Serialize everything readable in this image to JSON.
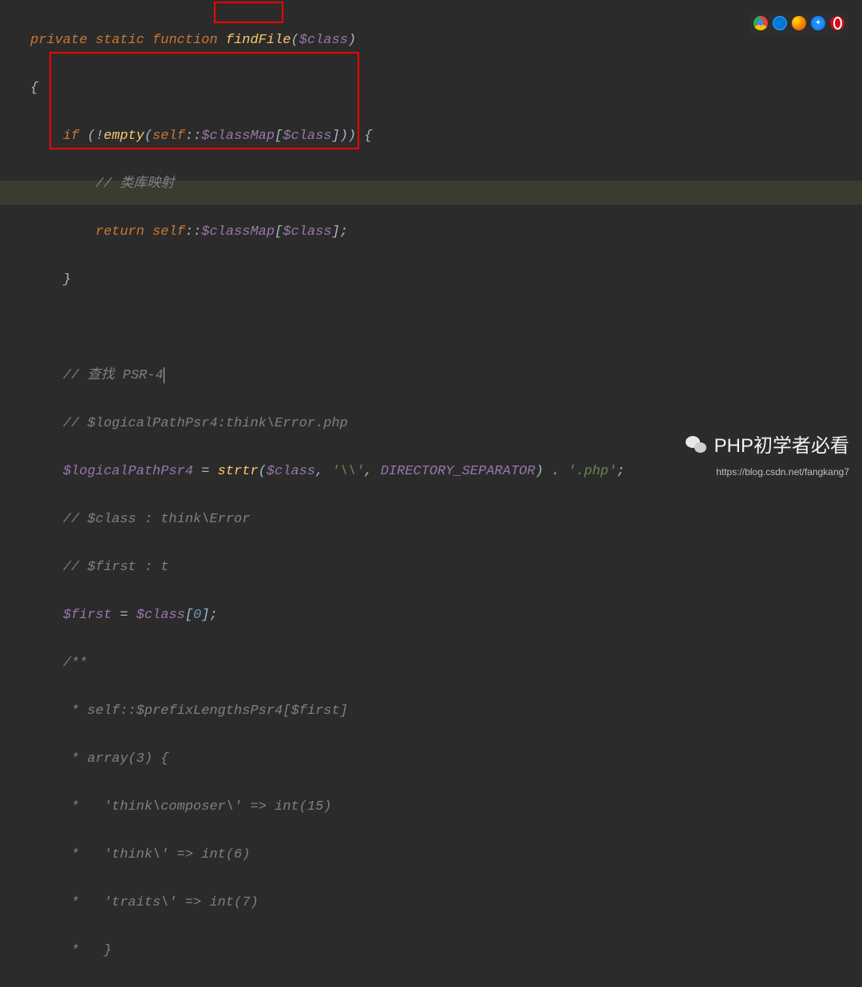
{
  "code": {
    "l1": {
      "private": "private",
      "static": "static",
      "function": "function",
      "name": "findFile",
      "open": "(",
      "var": "$class",
      "close": ")"
    },
    "l2": "{",
    "l3": {
      "if": "if",
      "open": " (!",
      "empty": "empty",
      "p1": "(",
      "self": "self",
      "scope": "::",
      "var": "$classMap",
      "b1": "[",
      "cls": "$class",
      "b2": "])) {"
    },
    "l4": {
      "txt": "// 类库映射"
    },
    "l5": {
      "ret": "return",
      "sp": " ",
      "self": "self",
      "scope": "::",
      "var": "$classMap",
      "b1": "[",
      "cls": "$class",
      "b2": "];"
    },
    "l6": "}",
    "l8": "// 查找 PSR-4",
    "l9": "// $logicalPathPsr4:think\\Error.php",
    "l10": {
      "v": "$logicalPathPsr4",
      "eq": " = ",
      "fn": "strtr",
      "p": "(",
      "cls": "$class",
      "c1": ", ",
      "s1": "'\\\\'",
      "c2": ", ",
      "const": "DIRECTORY_SEPARATOR",
      "close": ") . ",
      "s2": "'.php'",
      "semi": ";"
    },
    "l11": "// $class : think\\Error",
    "l12": "// $first : t",
    "l13": {
      "v": "$first",
      "eq": " = ",
      "cls": "$class",
      "b1": "[",
      "idx": "0",
      "b2": "];"
    },
    "l14": "/**",
    "l15": " * self::$prefixLengthsPsr4[$first]",
    "l16": " * array(3) {",
    "l17": " *   'think\\composer\\' => int(15)",
    "l18": " *   'think\\' => int(6)",
    "l19": " *   'traits\\' => int(7)",
    "l20": " *   }"
  },
  "icons": {
    "chrome": "chrome-icon",
    "edge": "edge-icon",
    "firefox": "firefox-icon",
    "safari": "safari-icon",
    "opera": "opera-icon"
  },
  "watermark": {
    "title": "PHP初学者必看",
    "url": "https://blog.csdn.net/fangkang7"
  }
}
